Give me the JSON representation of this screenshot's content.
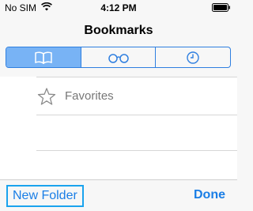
{
  "status_bar": {
    "carrier": "No SIM",
    "time": "4:12 PM",
    "wifi_icon": "wifi-icon",
    "battery_icon": "battery-icon"
  },
  "nav": {
    "title": "Bookmarks"
  },
  "segments": [
    {
      "icon": "book-icon",
      "selected": true
    },
    {
      "icon": "reading-glasses-icon",
      "selected": false
    },
    {
      "icon": "clock-icon",
      "selected": false
    }
  ],
  "list": {
    "items": [
      {
        "icon": "star-icon",
        "label": "Favorites"
      }
    ]
  },
  "toolbar": {
    "new_folder_label": "New Folder",
    "done_label": "Done"
  },
  "colors": {
    "accent": "#1a7ee6",
    "segment_selected": "#78b3f5",
    "highlight_border": "#1aa3ee"
  }
}
